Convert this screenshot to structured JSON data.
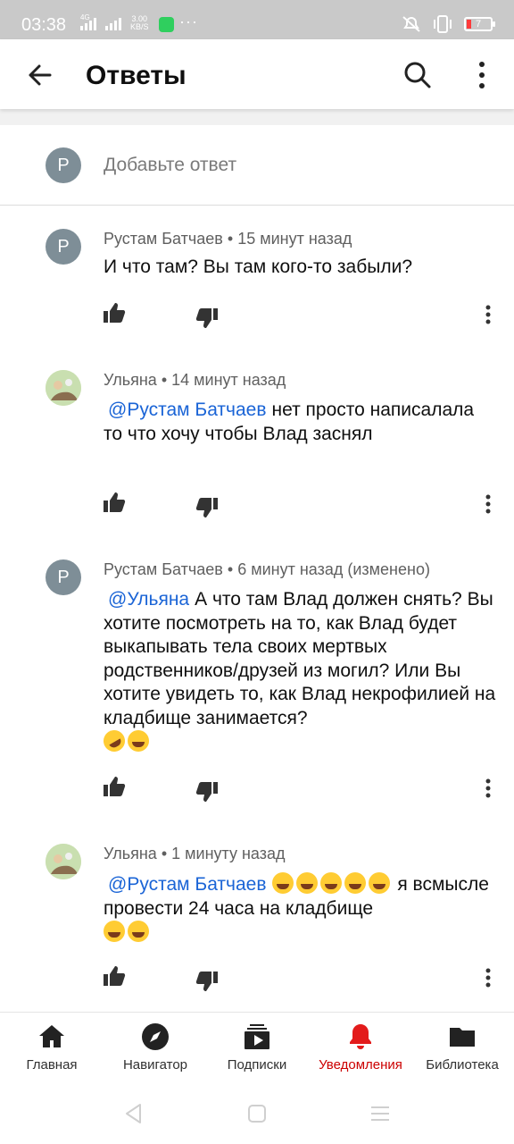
{
  "status_bar": {
    "time": "03:38",
    "net_tag": "4G",
    "speed_value": "3.00",
    "speed_unit": "KB/S",
    "extra": "···",
    "battery": "7"
  },
  "header": {
    "title": "Ответы"
  },
  "add_reply": {
    "avatar_letter": "Р",
    "placeholder": "Добавьте ответ"
  },
  "comments": [
    {
      "avatar_letter": "Р",
      "author": "Рустам Батчаев",
      "time": "15 минут назад",
      "mention": "",
      "text": "И что там? Вы там кого-то забыли?",
      "emoji_count": 0
    },
    {
      "avatar_letter": "",
      "author": "Ульяна",
      "time": "14 минут назад",
      "mention": "@Рустам Батчаев",
      "text": "нет просто написалала то что хочу чтобы Влад заснял",
      "emoji_count": 0
    },
    {
      "avatar_letter": "Р",
      "author": "Рустам Батчаев",
      "time": "6 минут назад (изменено)",
      "mention": "@Ульяна",
      "text": "А что там Влад должен снять? Вы хотите посмотреть на то, как Влад будет выкапывать тела своих мертвых родственников/друзей из могил? Или Вы хотите увидеть то, как Влад некрофилией на кладбище занимается?",
      "emoji_count": 2
    },
    {
      "avatar_letter": "",
      "author": "Ульяна",
      "time": "1 минуту назад",
      "mention": "@Рустам Батчаев",
      "text_after_emoji": "я всмысле провести 24 часа на кладбище",
      "emoji_count": 7
    }
  ],
  "separator": "•",
  "bottom_nav": [
    {
      "label": "Главная",
      "icon": "home-icon",
      "active": false
    },
    {
      "label": "Навигатор",
      "icon": "compass-icon",
      "active": false
    },
    {
      "label": "Подписки",
      "icon": "subscriptions-icon",
      "active": false
    },
    {
      "label": "Уведомления",
      "icon": "bell-icon",
      "active": true
    },
    {
      "label": "Библиотека",
      "icon": "folder-icon",
      "active": false
    }
  ],
  "colors": {
    "accent_red": "#cc0000",
    "mention_blue": "#1a64d6",
    "avatar_grey": "#7e8e97"
  }
}
